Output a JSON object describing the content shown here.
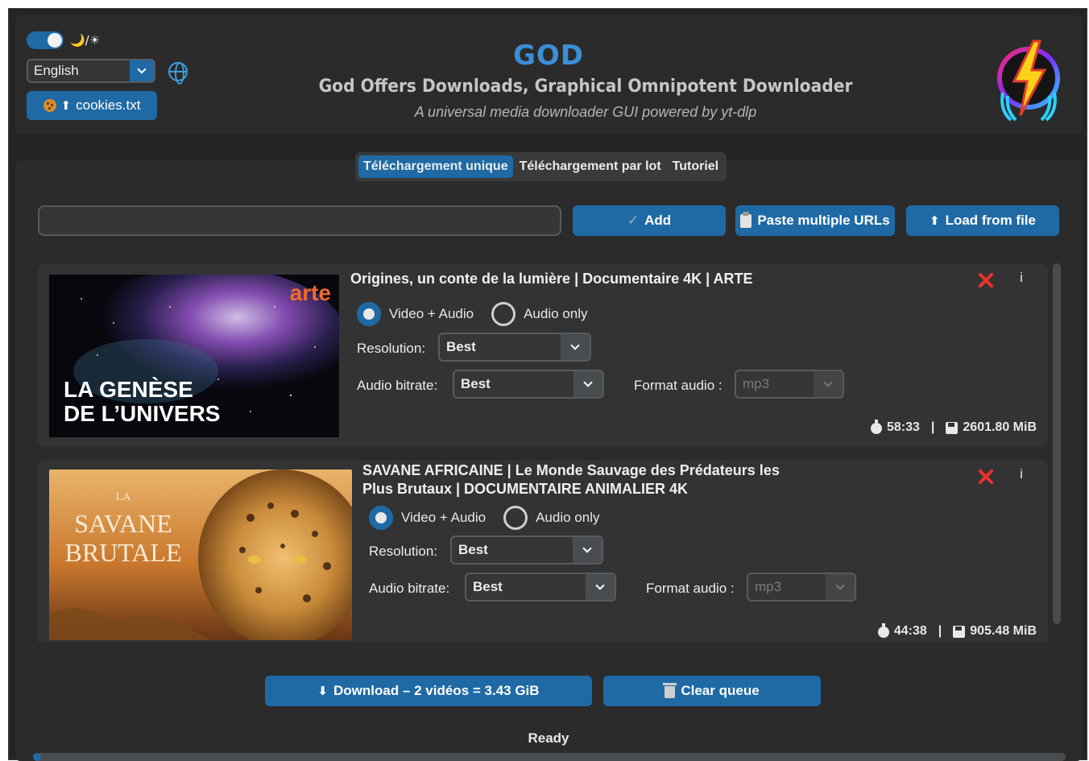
{
  "header": {
    "theme_icons": "🌙/☀",
    "language": "English",
    "cookies_label": "cookies.txt",
    "title": "GOD",
    "subtitle": "God Offers Downloads, Graphical Omnipotent Downloader",
    "tagline": "A universal media downloader GUI powered by yt-dlp"
  },
  "tabs": [
    {
      "label": "Téléchargement unique",
      "active": true
    },
    {
      "label": "Téléchargement par lot",
      "active": false
    },
    {
      "label": "Tutoriel",
      "active": false
    }
  ],
  "url_bar": {
    "value": "",
    "add_label": "Add",
    "paste_label": "Paste multiple URLs",
    "load_label": "Load from file"
  },
  "queue": [
    {
      "title": "Origines, un conte de la lumière | Documentaire 4K | ARTE",
      "thumb_brand": "arte",
      "thumb_line1": "LA GENÈSE",
      "thumb_line2": "DE L’UNIVERS",
      "mode_video": "Video + Audio",
      "mode_audio": "Audio only",
      "selected_mode": "video",
      "resolution_label": "Resolution:",
      "resolution": "Best",
      "bitrate_label": "Audio bitrate:",
      "bitrate": "Best",
      "format_label": "Format audio :",
      "format": "mp3",
      "duration": "58:33",
      "size": "2601.80 MiB"
    },
    {
      "title": "SAVANE AFRICAINE | Le Monde Sauvage des Prédateurs les Plus Brutaux | DOCUMENTAIRE ANIMALIER 4K",
      "thumb_line0": "LA",
      "thumb_line1": "SAVANE",
      "thumb_line2": "BRUTALE",
      "mode_video": "Video + Audio",
      "mode_audio": "Audio only",
      "selected_mode": "video",
      "resolution_label": "Resolution:",
      "resolution": "Best",
      "bitrate_label": "Audio bitrate:",
      "bitrate": "Best",
      "format_label": "Format audio :",
      "format": "mp3",
      "duration": "44:38",
      "size": "905.48 MiB"
    }
  ],
  "footer": {
    "download_label": "Download – 2 vidéos = 3.43 GiB",
    "clear_label": "Clear queue",
    "status": "Ready",
    "progress": 0.0
  },
  "colors": {
    "accent": "#1f6aa5",
    "title": "#3a8fd6",
    "remove": "#e8322f",
    "background": "#242424",
    "panel": "#2b2b2b"
  },
  "icons": [
    "moon-icon",
    "sun-icon",
    "globe-icon",
    "cookie-icon",
    "upload-icon",
    "check-icon",
    "clipboard-icon",
    "stopwatch-icon",
    "floppy-icon",
    "download-icon",
    "trash-icon",
    "close-icon",
    "info-icon"
  ]
}
